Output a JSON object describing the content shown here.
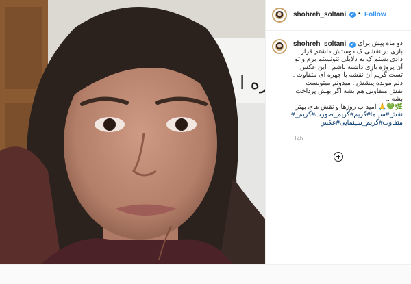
{
  "post": {
    "username": "shohreh_soltani",
    "verified_icon": "✔",
    "separator": "•",
    "follow_label": "Follow",
    "caption": {
      "username": "shohreh_soltani",
      "lines": [
        "دو ماه پیش برای",
        "بازی در نقشی ک دوستش داشتم قرار",
        "دادی بستم ک به دلایلی نتونستم برم و تو",
        "آن پروژه بازی داشته باشم . این عکس",
        "تست گریم آن نقشه با چهره ای متفاوت .",
        "دلم مونده پیشش . میدونم میتونست",
        "نقش متفاوتی هم بشه اگر بهش پرداخت",
        "بشه ..",
        "🌿💚🙏 امید ب روزها و نقش های بهتر",
        "نقش#سینما#گریم#گریم_صورت#گریم_#",
        "متفاوت#گریم_سینمایی#عکس"
      ]
    },
    "timestamp": "14h",
    "add_comment_icon": "plus-circle-icon"
  },
  "colors": {
    "link": "#3897f0",
    "text": "#262626",
    "muted": "#999999",
    "hashtag": "#003569"
  }
}
